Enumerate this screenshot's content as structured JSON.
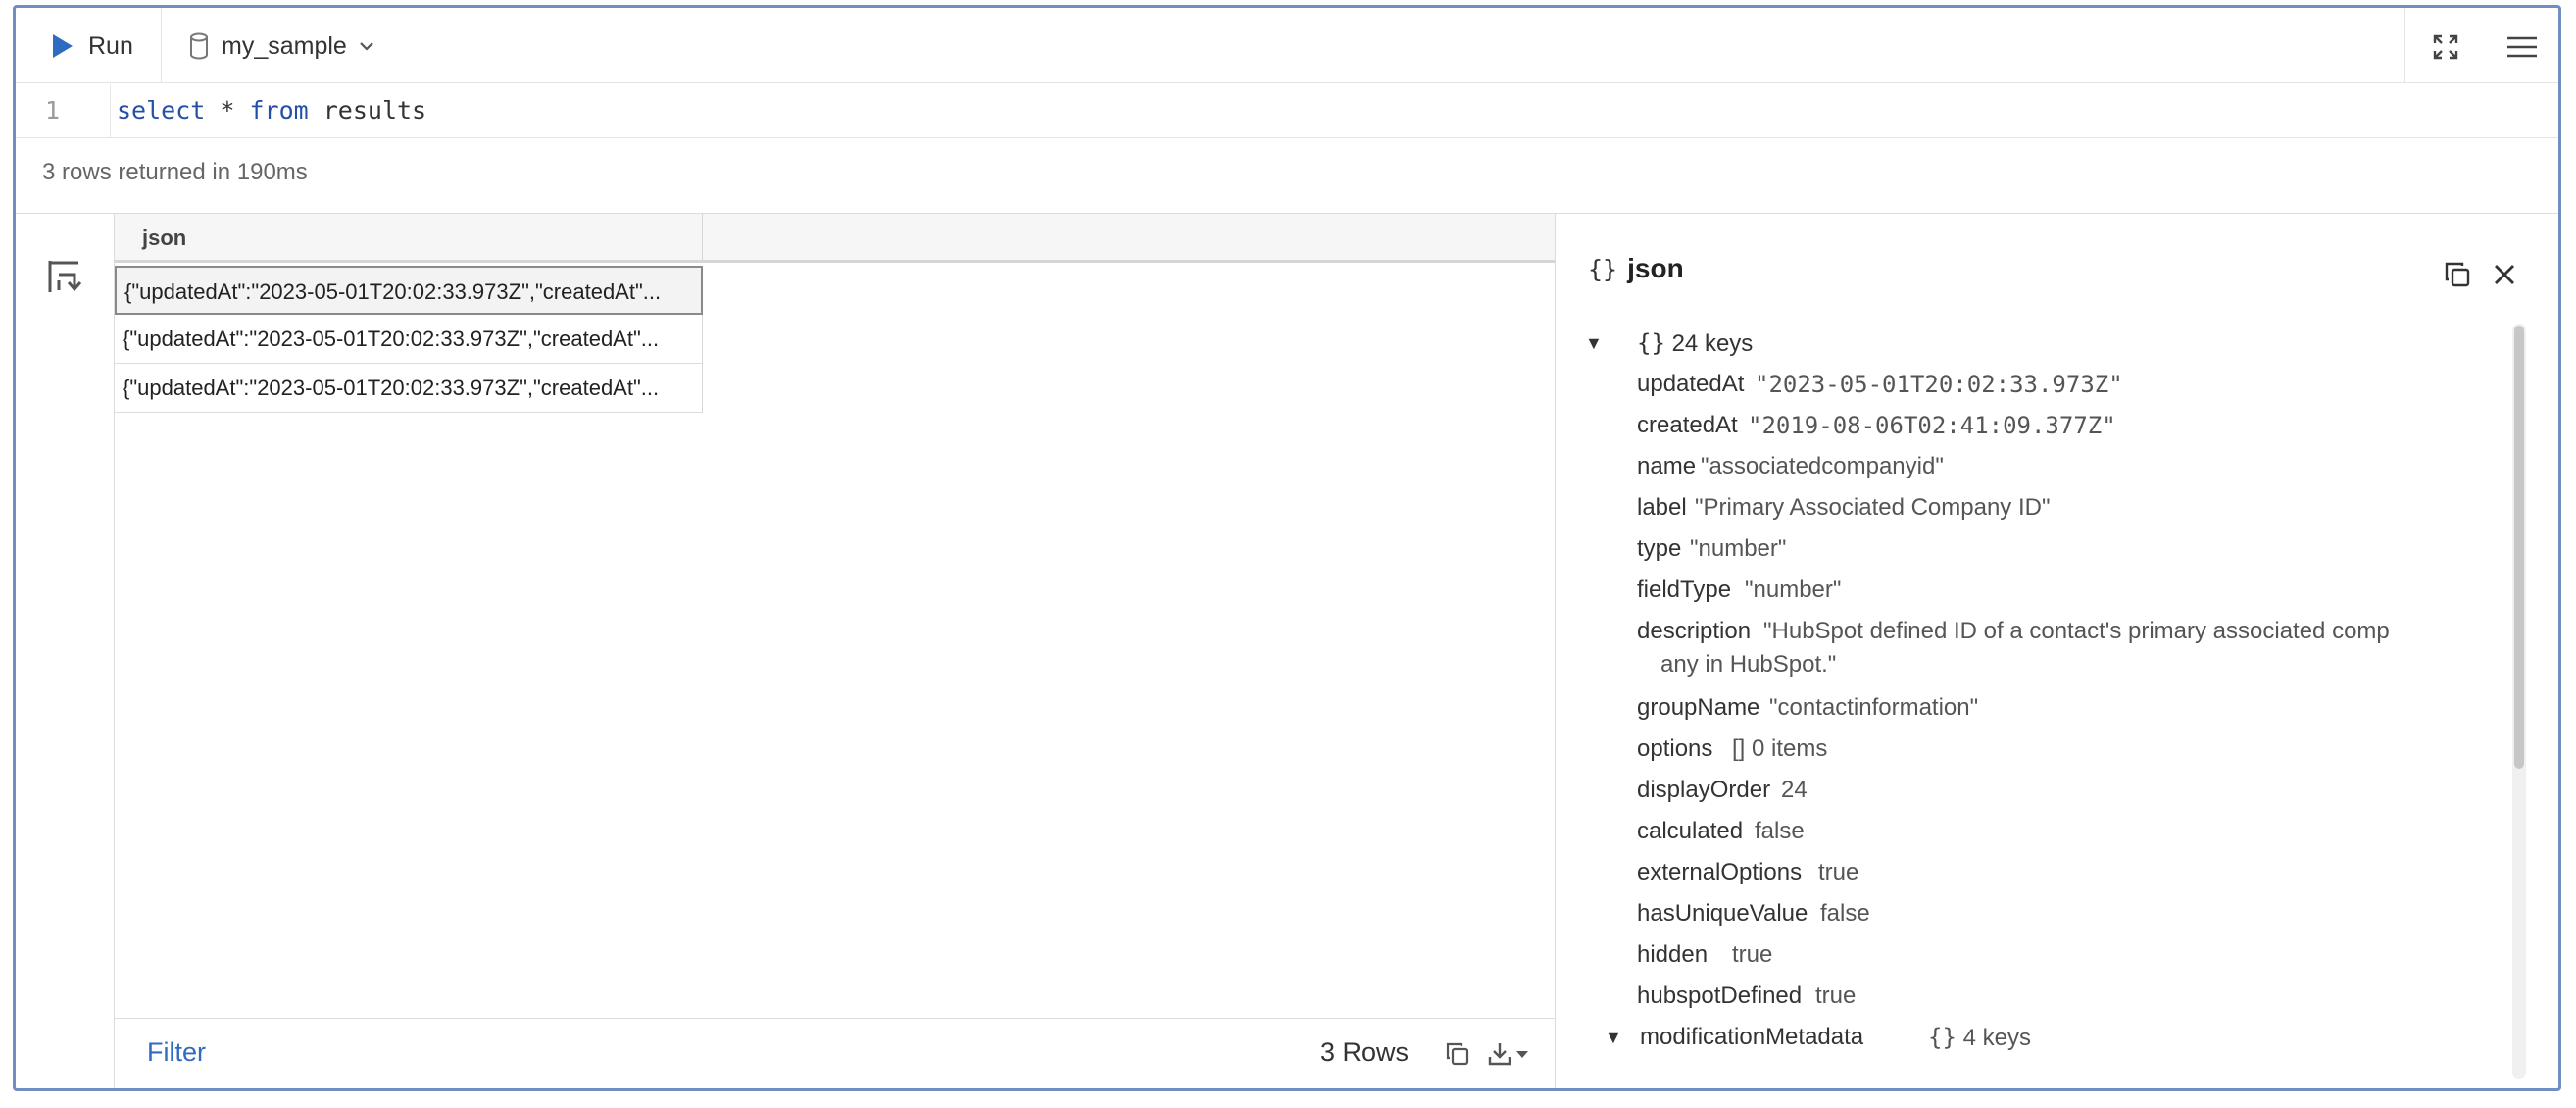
{
  "toolbar": {
    "run_label": "Run",
    "database": "my_sample"
  },
  "editor": {
    "line_number": "1",
    "kw_select": "select",
    "star": " * ",
    "kw_from": "from",
    "table": " results"
  },
  "status": "3 rows returned in 190ms",
  "grid": {
    "column_header": "json",
    "rows": [
      "{\"updatedAt\":\"2023-05-01T20:02:33.973Z\",\"createdAt\"...",
      "{\"updatedAt\":\"2023-05-01T20:02:33.973Z\",\"createdAt\"...",
      "{\"updatedAt\":\"2023-05-01T20:02:33.973Z\",\"createdAt\"..."
    ],
    "filter_label": "Filter",
    "row_count": "3 Rows"
  },
  "panel": {
    "brace": "{}",
    "title": "json",
    "root_brace": "{}",
    "root_meta": "24 keys",
    "fields": [
      {
        "key": "updatedAt",
        "value": "\"2023-05-01T20:02:33.973Z\""
      },
      {
        "key": "createdAt",
        "value": "\"2019-08-06T02:41:09.377Z\""
      },
      {
        "key": "name",
        "value": "\"associatedcompanyid\""
      },
      {
        "key": "label",
        "value": "\"Primary Associated Company ID\""
      },
      {
        "key": "type",
        "value": "\"number\""
      },
      {
        "key": "fieldType",
        "value": "\"number\""
      },
      {
        "key": "description",
        "value": "\"HubSpot defined ID of a contact's primary associated comp",
        "value_cont": "any in HubSpot.\""
      },
      {
        "key": "groupName",
        "value": "\"contactinformation\""
      },
      {
        "key": "options",
        "value": "[] 0 items"
      },
      {
        "key": "displayOrder",
        "value": "24"
      },
      {
        "key": "calculated",
        "value": "false"
      },
      {
        "key": "externalOptions",
        "value": "true"
      },
      {
        "key": "hasUniqueValue",
        "value": "false"
      },
      {
        "key": "hidden",
        "value": "true"
      },
      {
        "key": "hubspotDefined",
        "value": "true"
      }
    ],
    "nested": {
      "key": "modificationMetadata",
      "brace": "{}",
      "meta": "4 keys"
    }
  }
}
